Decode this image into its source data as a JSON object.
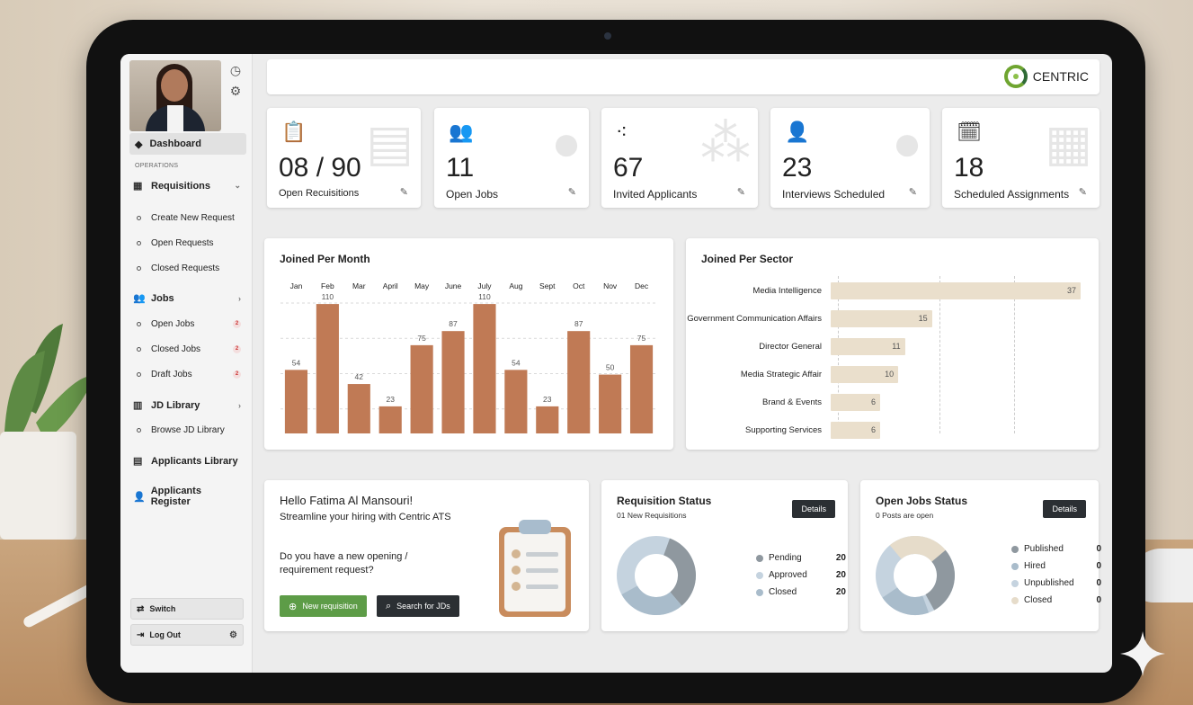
{
  "brand": {
    "name": "CENTRIC"
  },
  "sidebar": {
    "dashboard": "Dashboard",
    "section": "OPERATIONS",
    "requisitions": {
      "label": "Requisitions",
      "items": [
        "Create New Request",
        "Open Requests",
        "Closed Requests"
      ]
    },
    "jobs": {
      "label": "Jobs",
      "items": [
        {
          "label": "Open Jobs",
          "badge": "2"
        },
        {
          "label": "Closed Jobs",
          "badge": "2"
        },
        {
          "label": "Draft Jobs",
          "badge": "2"
        }
      ]
    },
    "jd_library": {
      "label": "JD Library",
      "items": [
        "Browse JD Library"
      ]
    },
    "applicants_library": "Applicants Library",
    "applicants_register": "Applicants Register",
    "switch": "Switch",
    "logout": "Log Out"
  },
  "stats": [
    {
      "value": "08 / 90",
      "label": "Open Recuisitions",
      "icon": "clipboard-icon"
    },
    {
      "value": "11",
      "label": "Open Jobs",
      "icon": "users-icon"
    },
    {
      "value": "67",
      "label": "Invited Applicants",
      "icon": "group-icon"
    },
    {
      "value": "23",
      "label": "Interviews Scheduled",
      "icon": "user-clock-icon"
    },
    {
      "value": "18",
      "label": "Scheduled Assignments",
      "icon": "calendar-clock-icon"
    }
  ],
  "joined_month": {
    "title": "Joined Per Month"
  },
  "joined_sector": {
    "title": "Joined Per Sector"
  },
  "chart_data": [
    {
      "type": "bar",
      "title": "Joined Per Month",
      "categories": [
        "Jan",
        "Feb",
        "Mar",
        "April",
        "May",
        "June",
        "July",
        "Aug",
        "Sept",
        "Oct",
        "Nov",
        "Dec"
      ],
      "values": [
        54,
        110,
        42,
        23,
        75,
        87,
        110,
        54,
        23,
        87,
        50,
        75
      ],
      "color": "#c07a55",
      "ylim": [
        0,
        120
      ],
      "grid": true
    },
    {
      "type": "bar",
      "orientation": "horizontal",
      "title": "Joined Per Sector",
      "categories": [
        "Media Intelligence",
        "Government Communication Affairs",
        "Director General",
        "Media Strategic Affair",
        "Brand & Events",
        "Supporting Services"
      ],
      "values": [
        37,
        15,
        11,
        10,
        6,
        6
      ],
      "color": "#eadfcc",
      "xlim": [
        0,
        37
      ]
    }
  ],
  "welcome": {
    "greeting": "Hello Fatima Al Mansouri!",
    "subtitle": "Streamline your hiring with Centric ATS",
    "question_line1": "Do you have a new opening /",
    "question_line2": "requirement request?",
    "new_btn": "New requisition",
    "search_btn": "Search for JDs"
  },
  "requisition_status": {
    "title": "Requisition Status",
    "subtitle": "01 New Requisitions",
    "details": "Details",
    "legend": [
      {
        "label": "Pending",
        "value": "20",
        "color": "#8f989f"
      },
      {
        "label": "Approved",
        "value": "20",
        "color": "#c5d3df"
      },
      {
        "label": "Closed",
        "value": "20",
        "color": "#a9bccb"
      }
    ]
  },
  "open_jobs_status": {
    "title": "Open Jobs Status",
    "subtitle": "0 Posts are open",
    "details": "Details",
    "legend": [
      {
        "label": "Published",
        "value": "0",
        "color": "#8f989f"
      },
      {
        "label": "Hired",
        "value": "0",
        "color": "#a9bccb"
      },
      {
        "label": "Unpublished",
        "value": "0",
        "color": "#c5d3df"
      },
      {
        "label": "Closed",
        "value": "0",
        "color": "#e6dcca"
      }
    ]
  }
}
